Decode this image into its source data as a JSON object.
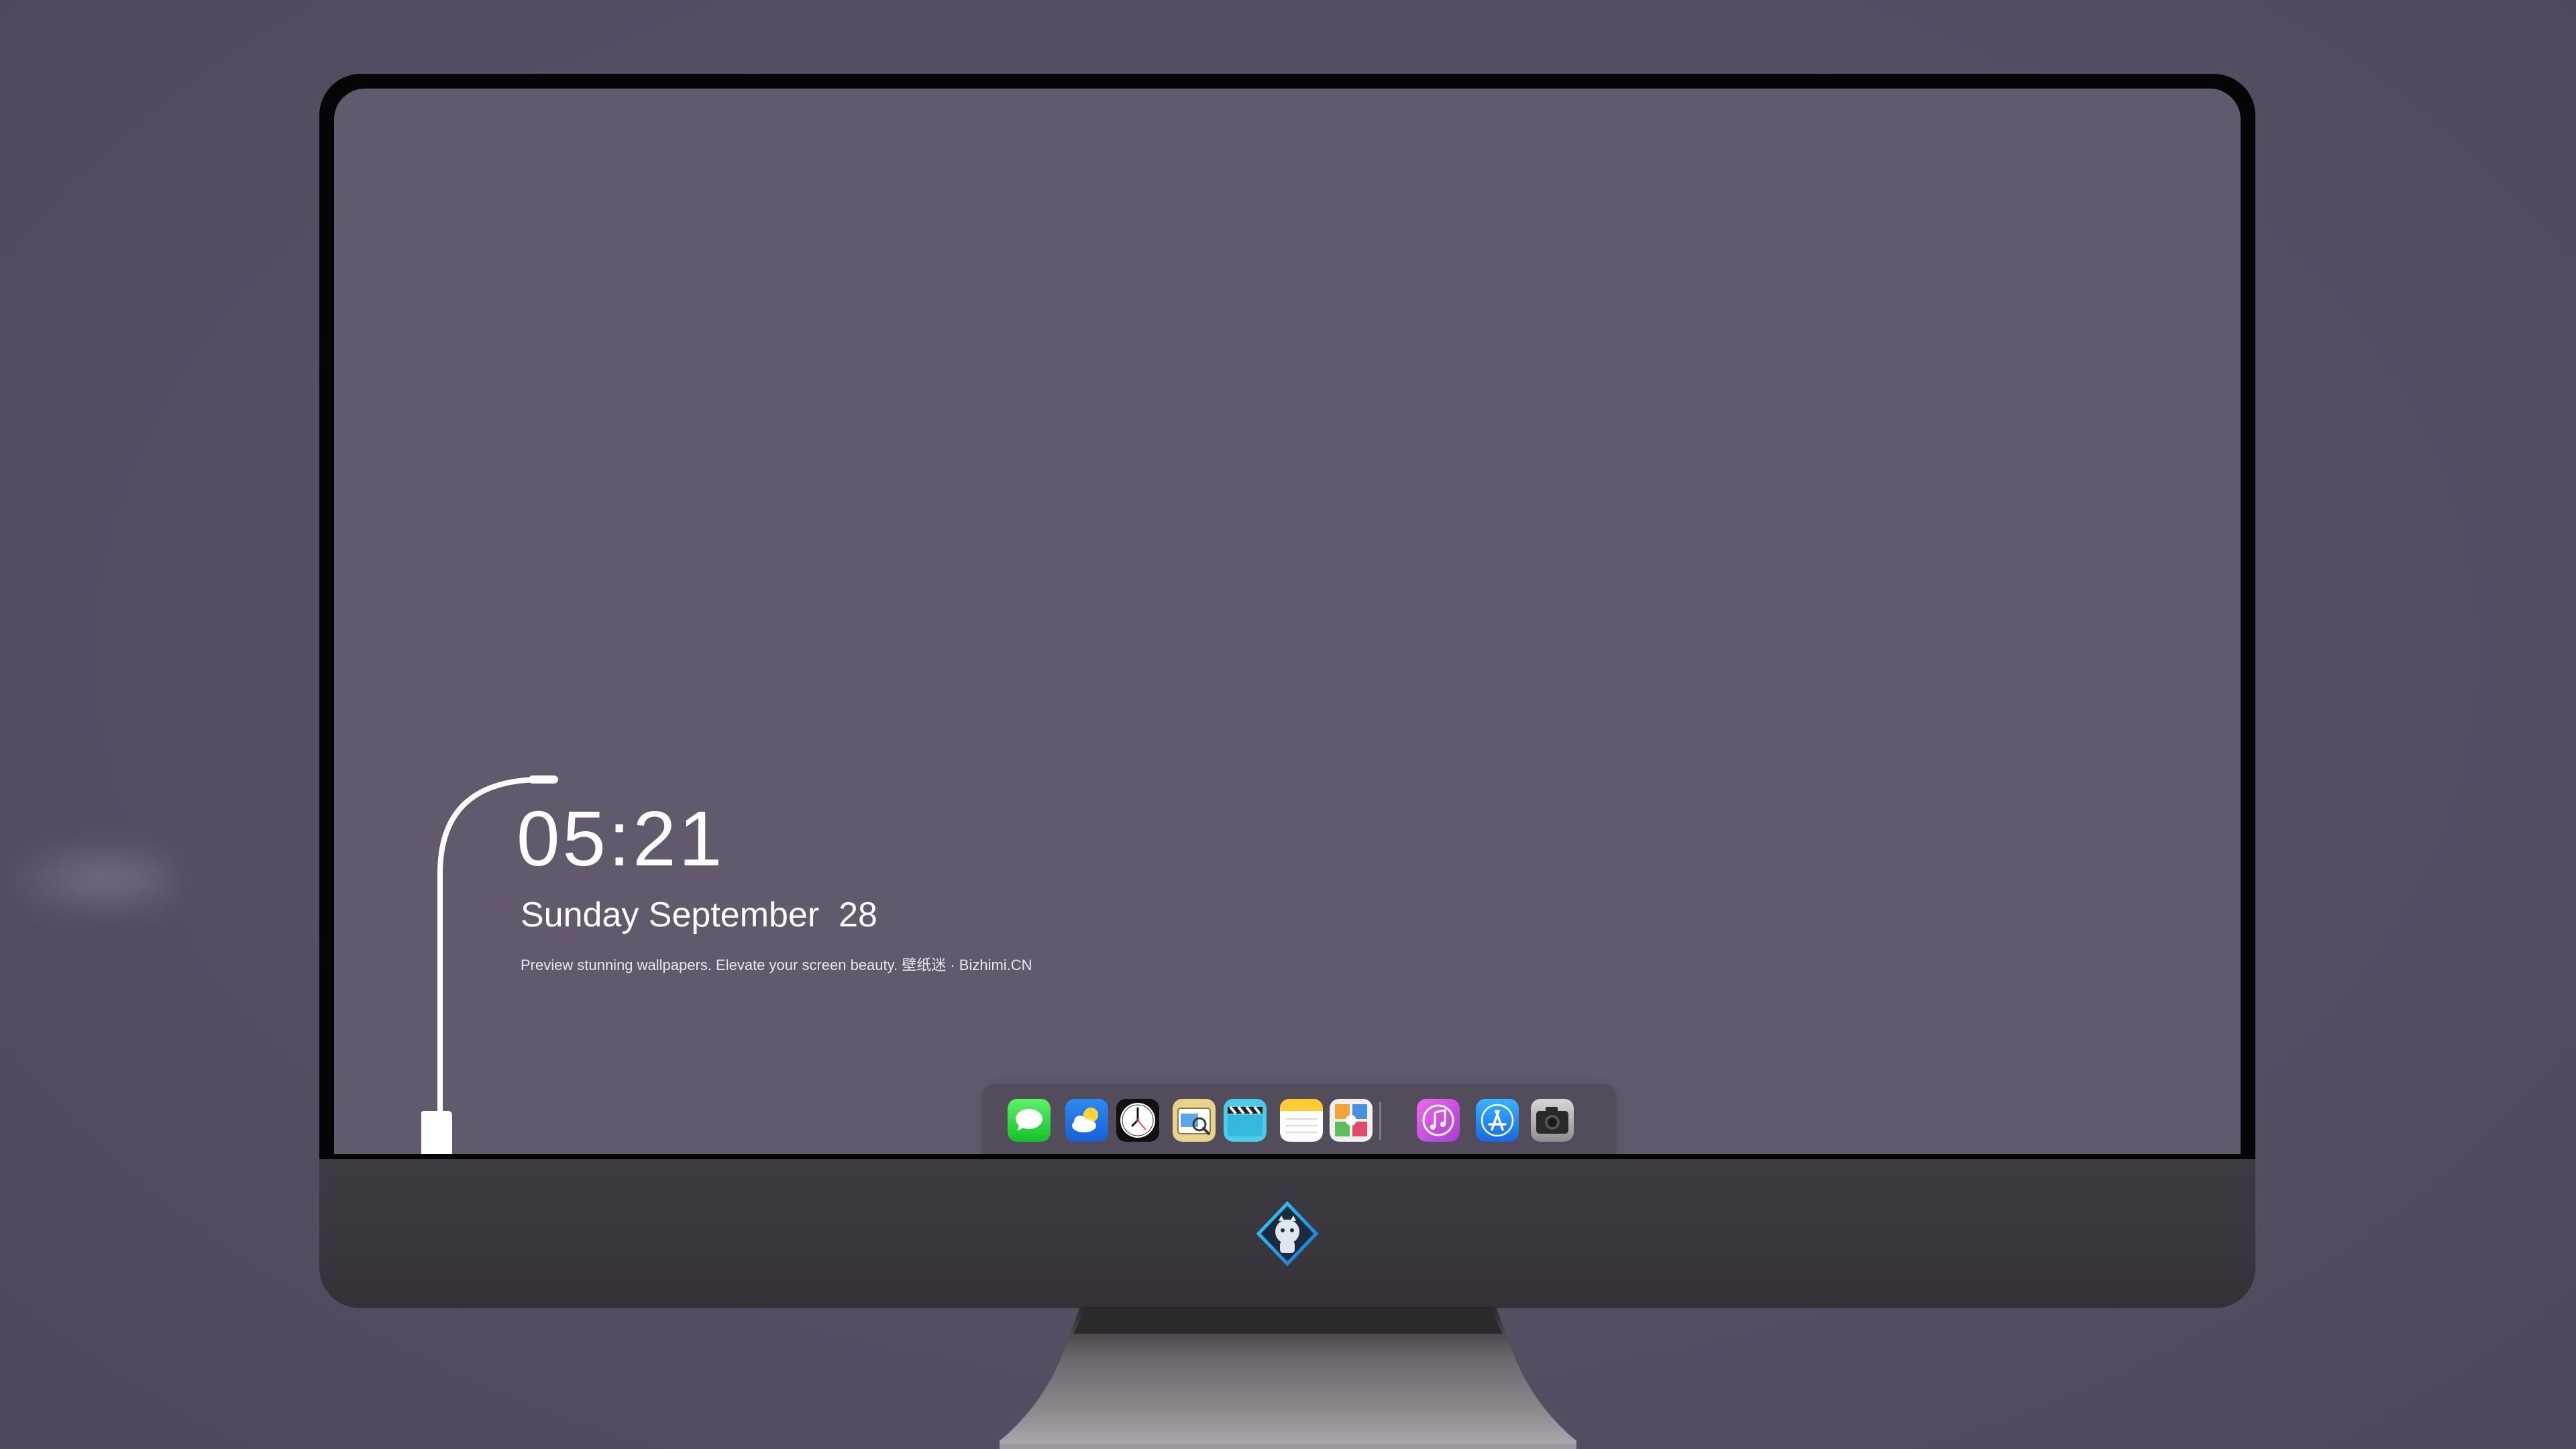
{
  "lockscreen": {
    "time": "05:21",
    "date": "Sunday September  28",
    "tagline": "Preview stunning wallpapers. Elevate your screen beauty. 壁纸迷 · Bizhimi.CN"
  },
  "dock": {
    "items": [
      {
        "icon": "messages-icon"
      },
      {
        "icon": "weather-icon"
      },
      {
        "icon": "clock-icon"
      },
      {
        "icon": "preview-icon"
      },
      {
        "icon": "claquette-icon"
      },
      {
        "icon": "notes-icon"
      },
      {
        "icon": "photo-collage-icon"
      },
      {
        "icon": "music-icon"
      },
      {
        "icon": "app-store-icon"
      },
      {
        "icon": "camera-icon"
      }
    ]
  },
  "colors": {
    "background": "#585065",
    "screen": "#62596c",
    "bezel": "#050505",
    "chin": "#3e3a42"
  }
}
